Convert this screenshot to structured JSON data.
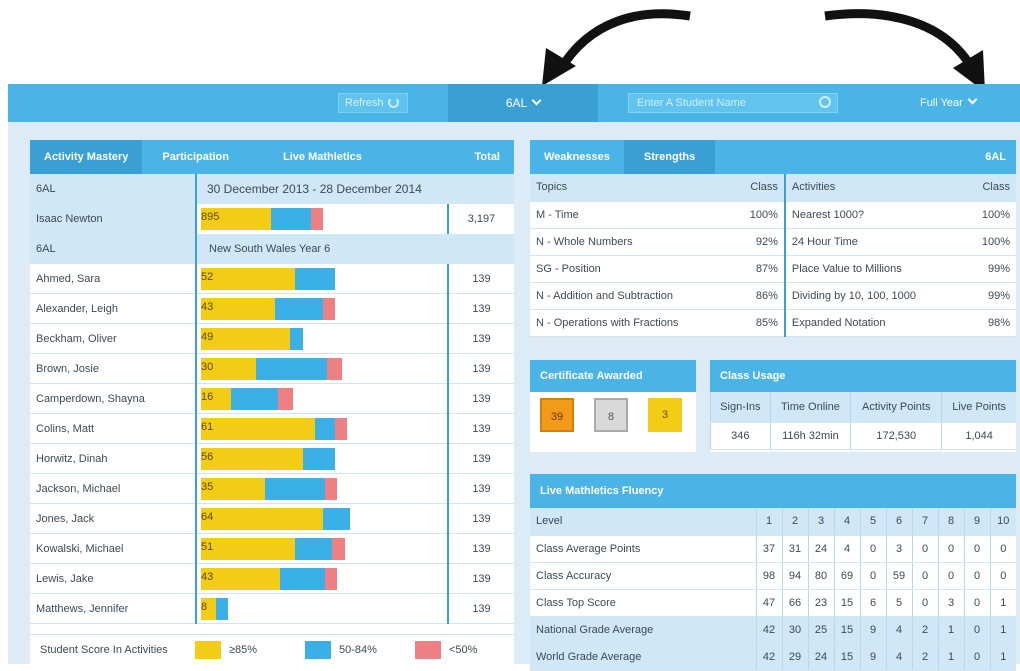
{
  "topbar": {
    "refresh": "Refresh",
    "class": "6AL",
    "search_placeholder": "Enter A Student Name",
    "period": "Full Year"
  },
  "left": {
    "tabs": [
      "Activity Mastery",
      "Participation",
      "Live Mathletics",
      "Total"
    ],
    "class_label": "6AL",
    "date_range": "30 December 2013 - 28 December 2014",
    "highlight": {
      "name": "Isaac Newton",
      "score": "895",
      "total": "3,197"
    },
    "group": {
      "label": "6AL",
      "curriculum": "New South Wales Year 6"
    },
    "students": [
      {
        "name": "Ahmed, Sara",
        "score": "52",
        "y": 0.38,
        "b": 0.16,
        "r": 0,
        "total": "139"
      },
      {
        "name": "Alexander, Leigh",
        "score": "43",
        "y": 0.3,
        "b": 0.19,
        "r": 0.05,
        "total": "139"
      },
      {
        "name": "Beckham, Oliver",
        "score": "49",
        "y": 0.36,
        "b": 0.05,
        "r": 0,
        "total": "139"
      },
      {
        "name": "Brown, Josie",
        "score": "30",
        "y": 0.22,
        "b": 0.29,
        "r": 0.06,
        "total": "139"
      },
      {
        "name": "Camperdown, Shayna",
        "score": "16",
        "y": 0.12,
        "b": 0.19,
        "r": 0.06,
        "total": "139"
      },
      {
        "name": "Colins, Matt",
        "score": "61",
        "y": 0.46,
        "b": 0.08,
        "r": 0.05,
        "total": "139"
      },
      {
        "name": "Horwitz, Dinah",
        "score": "56",
        "y": 0.41,
        "b": 0.13,
        "r": 0,
        "total": "139"
      },
      {
        "name": "Jackson, Michael",
        "score": "35",
        "y": 0.26,
        "b": 0.24,
        "r": 0.05,
        "total": "139"
      },
      {
        "name": "Jones, Jack",
        "score": "64",
        "y": 0.49,
        "b": 0.11,
        "r": 0,
        "total": "139"
      },
      {
        "name": "Kowalski, Michael",
        "score": "51",
        "y": 0.38,
        "b": 0.15,
        "r": 0.05,
        "total": "139"
      },
      {
        "name": "Lewis, Jake",
        "score": "43",
        "y": 0.32,
        "b": 0.18,
        "r": 0.05,
        "total": "139"
      },
      {
        "name": "Matthews, Jennifer",
        "score": "8",
        "y": 0.06,
        "b": 0.05,
        "r": 0,
        "total": "139"
      }
    ],
    "legend": {
      "label": "Student Score In Activities",
      "a": "≥85%",
      "b": "50-84%",
      "c": "<50%"
    }
  },
  "weak": {
    "tabs": [
      "Weaknesses",
      "Strengths"
    ],
    "class": "6AL",
    "h": [
      "Topics",
      "Class",
      "Activities",
      "Class"
    ],
    "rows": [
      [
        "M - Time",
        "100%",
        "Nearest 1000?",
        "100%"
      ],
      [
        "N - Whole Numbers",
        "92%",
        "24 Hour Time",
        "100%"
      ],
      [
        "SG - Position",
        "87%",
        "Place Value to Millions",
        "99%"
      ],
      [
        "N - Addition and Subtraction",
        "86%",
        "Dividing by 10, 100, 1000",
        "99%"
      ],
      [
        "N - Operations with Fractions",
        "85%",
        "Expanded Notation",
        "98%"
      ]
    ]
  },
  "cert": {
    "title": "Certificate Awarded",
    "gold": "39",
    "silver": "8",
    "bronze": "3"
  },
  "usage": {
    "title": "Class Usage",
    "h": [
      "Sign-Ins",
      "Time Online",
      "Activity Points",
      "Live Points"
    ],
    "v": [
      "346",
      "116h 32min",
      "172,530",
      "1,044"
    ]
  },
  "fluency": {
    "title": "Live Mathletics Fluency",
    "h": [
      "Level",
      "1",
      "2",
      "3",
      "4",
      "5",
      "6",
      "7",
      "8",
      "9",
      "10"
    ],
    "rows": [
      [
        "Class Average Points",
        "37",
        "31",
        "24",
        "4",
        "0",
        "3",
        "0",
        "0",
        "0",
        "0"
      ],
      [
        "Class Accuracy",
        "98",
        "94",
        "80",
        "69",
        "0",
        "59",
        "0",
        "0",
        "0",
        "0"
      ],
      [
        "Class Top Score",
        "47",
        "66",
        "23",
        "15",
        "6",
        "5",
        "0",
        "3",
        "0",
        "1"
      ],
      [
        "National Grade Average",
        "42",
        "30",
        "25",
        "15",
        "9",
        "4",
        "2",
        "1",
        "0",
        "1"
      ],
      [
        "World Grade Average",
        "42",
        "29",
        "24",
        "15",
        "9",
        "4",
        "2",
        "1",
        "0",
        "1"
      ]
    ]
  },
  "colors": {
    "accent": "#4bb4e6",
    "dark": "#3a9fd3",
    "yellow": "#f3cc16",
    "blue": "#3bb0e6",
    "red": "#ee7f82"
  }
}
